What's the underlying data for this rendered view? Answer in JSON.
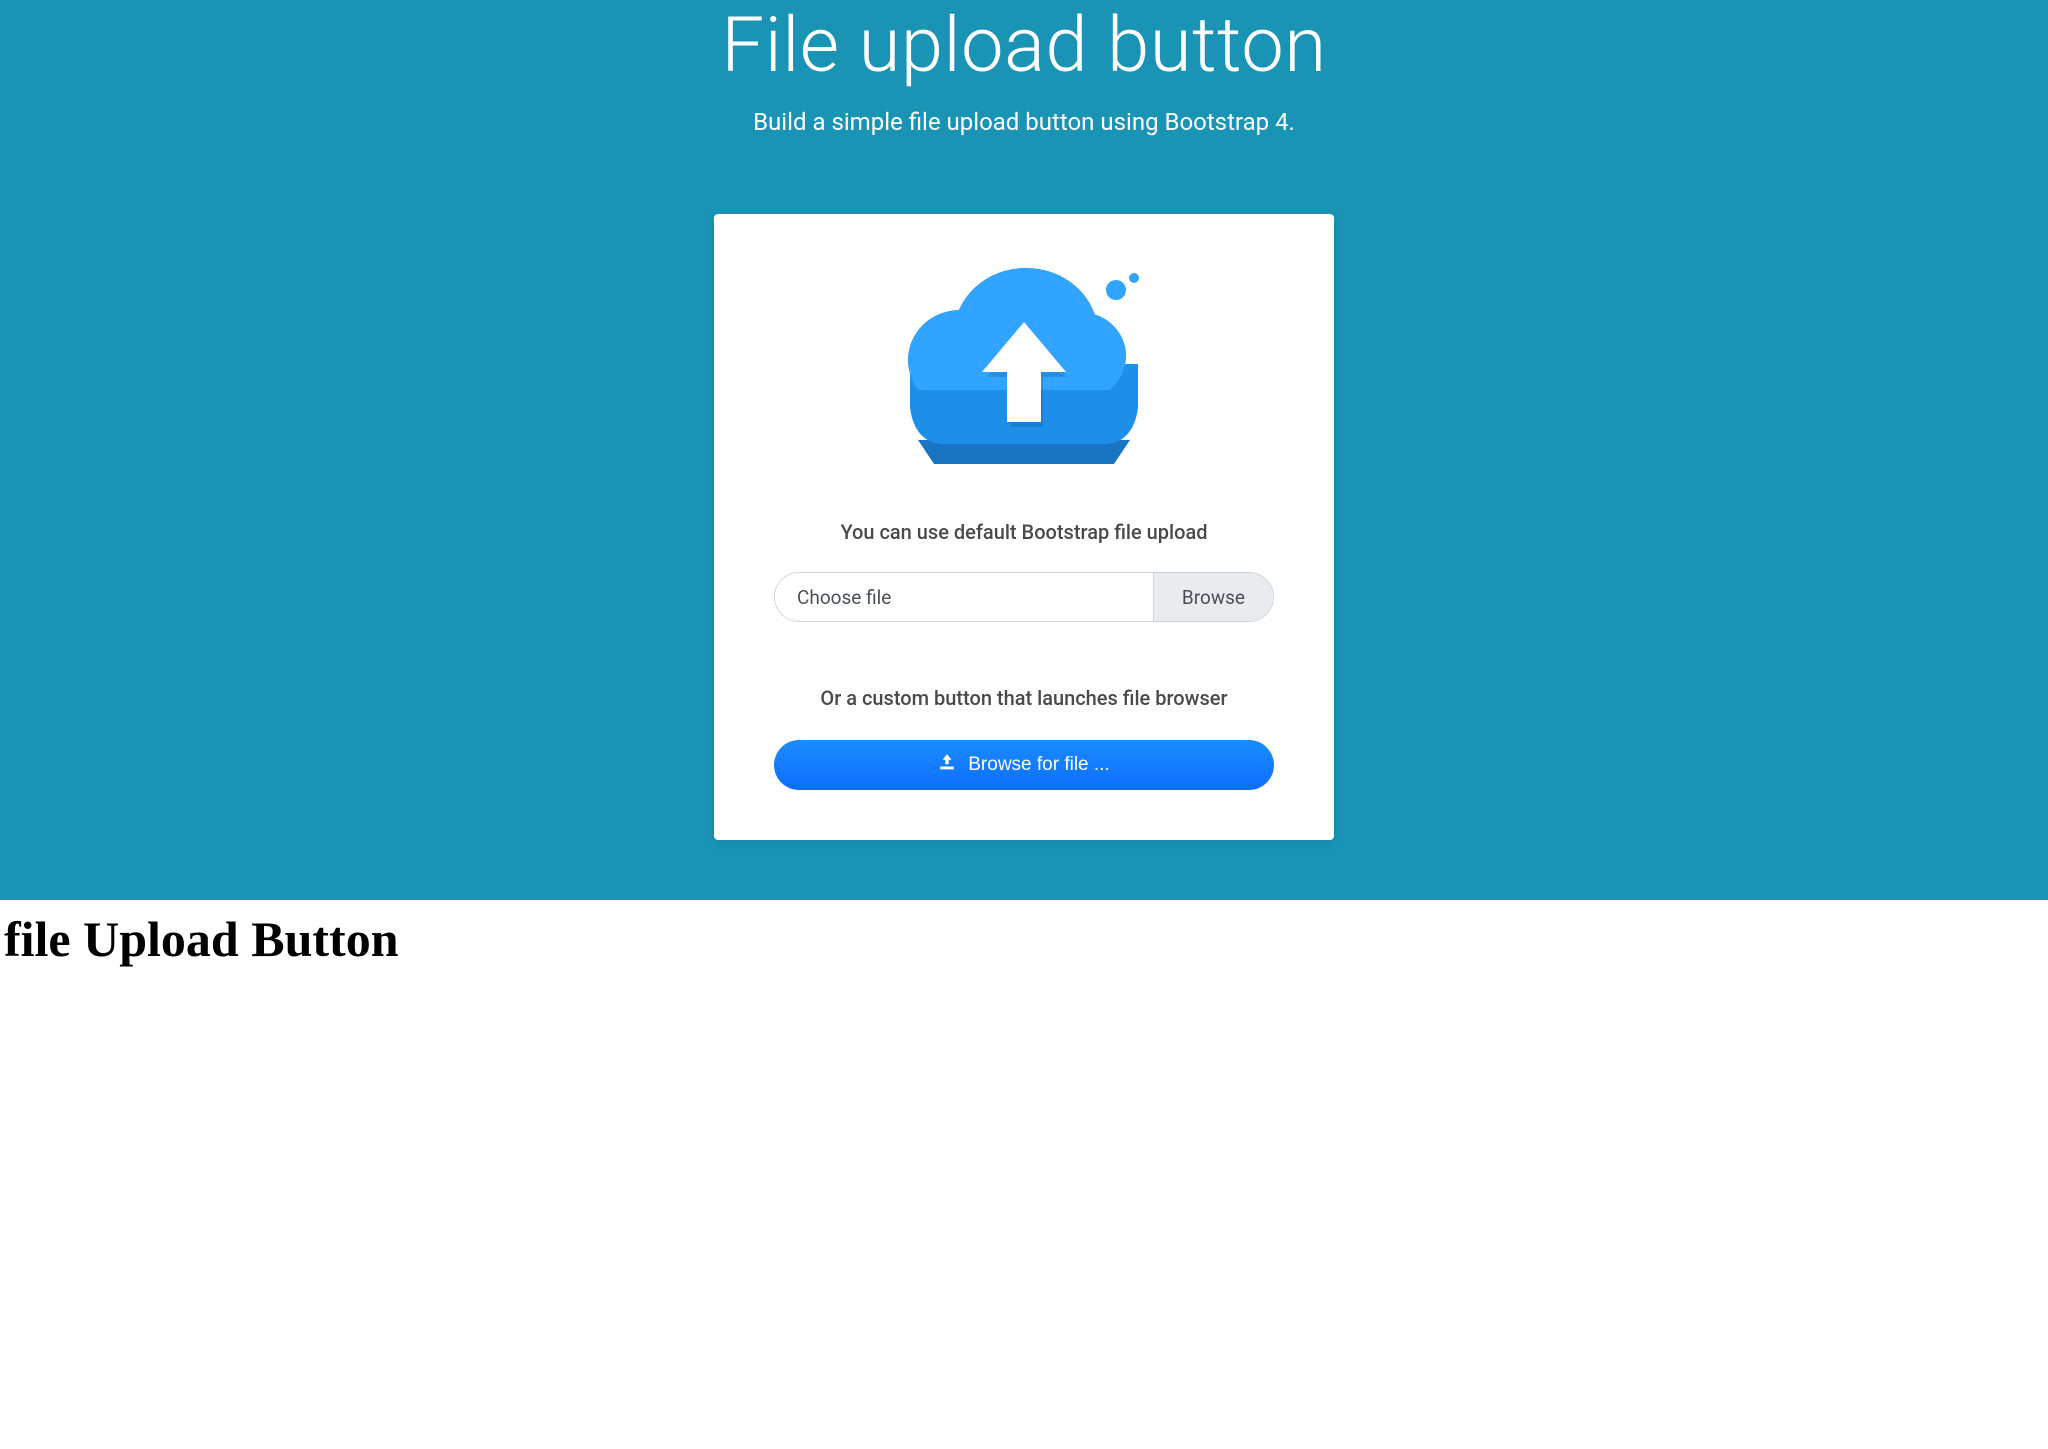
{
  "hero": {
    "title": "File upload button",
    "subtitle": "Build a simple file upload button using Bootstrap 4."
  },
  "card": {
    "default_label": "You can use default Bootstrap file upload",
    "file_placeholder": "Choose file",
    "browse_label": "Browse",
    "custom_label": "Or a custom button that launches file browser",
    "browse_button_label": "Browse for file ..."
  },
  "footer": {
    "title": "file Upload Button"
  },
  "colors": {
    "hero_bg": "#1994b5",
    "primary": "#0d6efd",
    "cloud_light": "#30a4ff",
    "cloud_dark": "#1e8fe8"
  }
}
